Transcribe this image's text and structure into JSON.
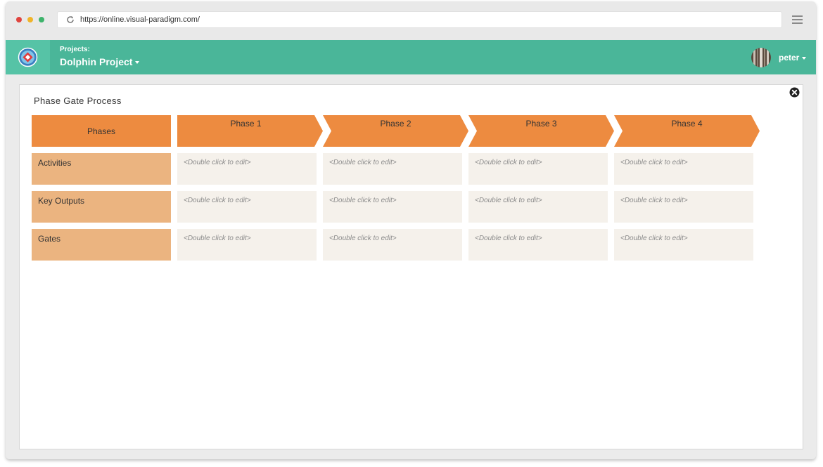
{
  "browser": {
    "url": "https://online.visual-paradigm.com/"
  },
  "appbar": {
    "project_label": "Projects:",
    "project_name": "Dolphin Project",
    "user_name": "peter",
    "accent_color": "#4ab699"
  },
  "diagram": {
    "title": "Phase Gate Process",
    "corner_header": "Phases",
    "phases": [
      "Phase 1",
      "Phase 2",
      "Phase 3",
      "Phase 4"
    ],
    "rows": [
      {
        "label": "Activities",
        "cells": [
          "<Double click to edit>",
          "<Double click to edit>",
          "<Double click to edit>",
          "<Double click to edit>"
        ]
      },
      {
        "label": "Key Outputs",
        "cells": [
          "<Double click to edit>",
          "<Double click to edit>",
          "<Double click to edit>",
          "<Double click to edit>"
        ]
      },
      {
        "label": "Gates",
        "cells": [
          "<Double click to edit>",
          "<Double click to edit>",
          "<Double click to edit>",
          "<Double click to edit>"
        ]
      }
    ],
    "colors": {
      "header": "#ed8b40",
      "row_label": "#ebb480",
      "cell": "#f5f1eb"
    }
  }
}
